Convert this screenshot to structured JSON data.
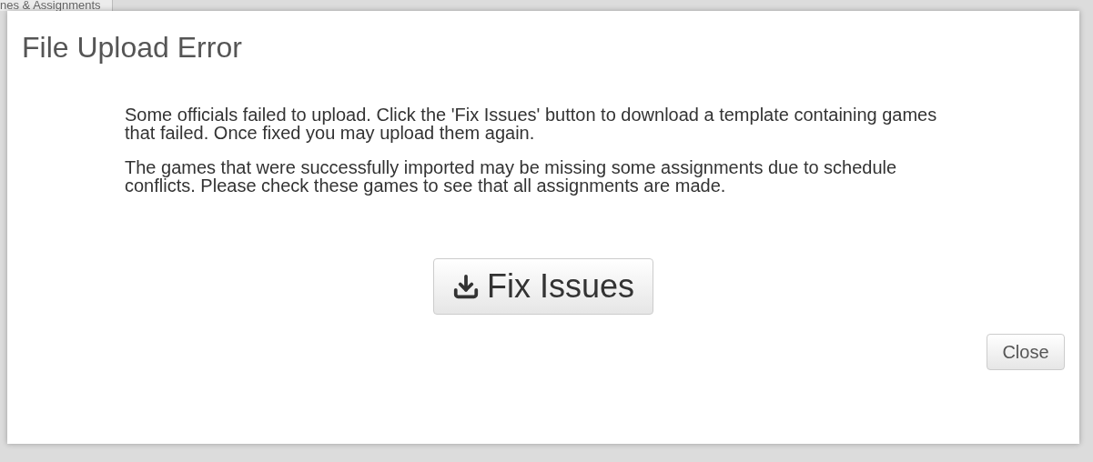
{
  "background": {
    "tab_label": "nes & Assignments"
  },
  "dialog": {
    "title": "File Upload Error",
    "paragraphs": [
      "Some officials failed to upload. Click the 'Fix Issues' button to download a template containing games that failed. Once fixed you may upload them again.",
      "The games that were successfully imported may be missing some assignments due to schedule conflicts. Please check these games to see that all assignments are made."
    ],
    "action_button": "Fix Issues",
    "close_button": "Close"
  }
}
